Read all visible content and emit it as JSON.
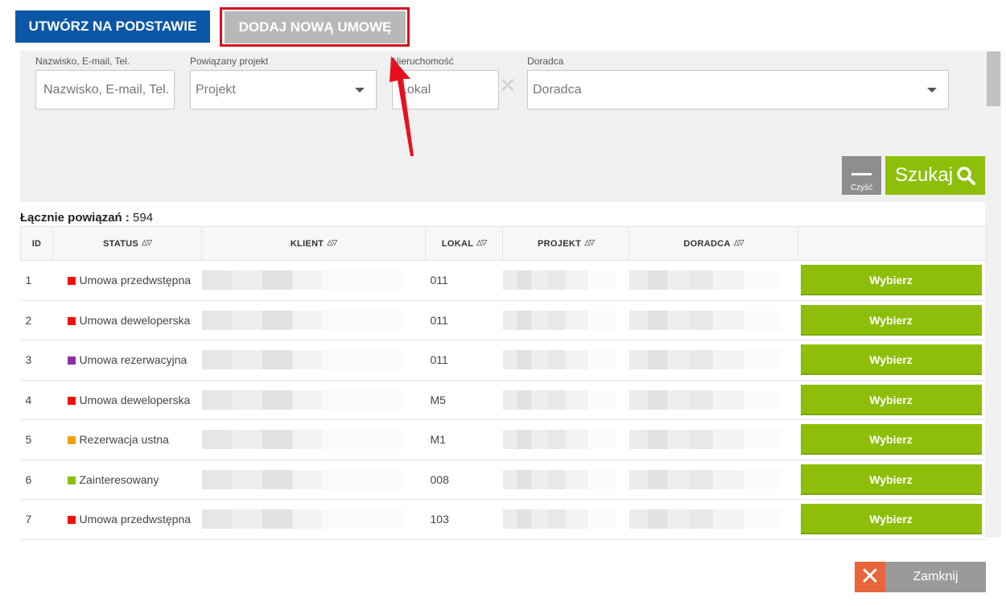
{
  "toolbar": {
    "create_based_label": "UTWÓRZ NA PODSTAWIE",
    "add_contract_label": "DODAJ NOWĄ UMOWĘ"
  },
  "filters": {
    "name": {
      "label": "Nazwisko, E-mail, Tel.",
      "placeholder": "Nazwisko, E-mail, Tel."
    },
    "project": {
      "label": "Powiązany projekt",
      "value": "Projekt"
    },
    "property": {
      "label": "Nieruchomość",
      "value": "Lokal"
    },
    "advisor": {
      "label": "Doradca",
      "value": "Doradca"
    },
    "clear_label": "Czyść",
    "search_label": "Szukaj"
  },
  "summary": {
    "label": "Łącznie powiązań :",
    "count": "594"
  },
  "table": {
    "headers": {
      "id": "ID",
      "status": "STATUS",
      "client": "KLIENT",
      "unit": "LOKAL",
      "project": "PROJEKT",
      "advisor": "DORADCA"
    },
    "select_label": "Wybierz",
    "rows": [
      {
        "id": "1",
        "status": "Umowa przedwstępna",
        "status_color": "#ee1111",
        "unit": "011"
      },
      {
        "id": "2",
        "status": "Umowa deweloperska",
        "status_color": "#ee1111",
        "unit": "011"
      },
      {
        "id": "3",
        "status": "Umowa rezerwacyjna",
        "status_color": "#8e2ca8",
        "unit": "011"
      },
      {
        "id": "4",
        "status": "Umowa deweloperska",
        "status_color": "#ee1111",
        "unit": "M5"
      },
      {
        "id": "5",
        "status": "Rezerwacja ustna",
        "status_color": "#f5a00a",
        "unit": "M1"
      },
      {
        "id": "6",
        "status": "Zainteresowany",
        "status_color": "#8dbf0a",
        "unit": "008"
      },
      {
        "id": "7",
        "status": "Umowa przedwstępna",
        "status_color": "#ee1111",
        "unit": "103"
      }
    ]
  },
  "footer": {
    "close_label": "Zamknij"
  },
  "colors": {
    "primary_blue": "#0b57a6",
    "accent_green": "#8dbf0a",
    "highlight_red": "#d4101e",
    "close_orange": "#e8643a"
  }
}
